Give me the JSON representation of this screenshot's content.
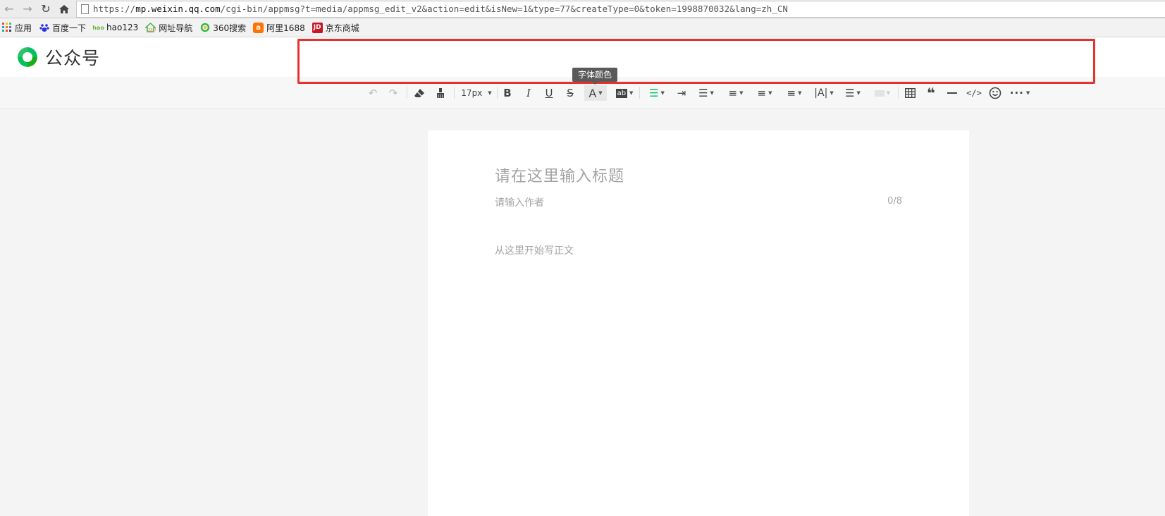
{
  "browser": {
    "url_prefix": "https://",
    "url_host": "mp.weixin.qq.com",
    "url_path": "/cgi-bin/appmsg?t=media/appmsg_edit_v2&action=edit&isNew=1&type=77&createType=0&token=1998870032&lang=zh_CN"
  },
  "bookmarks": [
    {
      "label": "应用",
      "icon": "apps-grid-icon",
      "color": "#e74c3c"
    },
    {
      "label": "百度一下",
      "icon": "baidu-paw-icon",
      "color": "#2932e1"
    },
    {
      "label": "hao123",
      "icon": "hao123-icon",
      "color": "#6cb33f"
    },
    {
      "label": "网址导航",
      "icon": "2345-icon",
      "color": "#4caf50"
    },
    {
      "label": "360搜索",
      "icon": "360-search-icon",
      "color": "#3bb54a"
    },
    {
      "label": "阿里1688",
      "icon": "ali1688-icon",
      "color": "#ff7300"
    },
    {
      "label": "京东商城",
      "icon": "jd-icon",
      "color": "#c81623"
    }
  ],
  "header": {
    "brand": "公众号",
    "accent": "#07c160"
  },
  "toolbar": {
    "font_size": "17px",
    "tooltip": "字体颜色"
  },
  "editor": {
    "title_placeholder": "请在这里输入标题",
    "author_placeholder": "请输入作者",
    "author_count": "0/8",
    "body_placeholder": "从这里开始写正文"
  }
}
